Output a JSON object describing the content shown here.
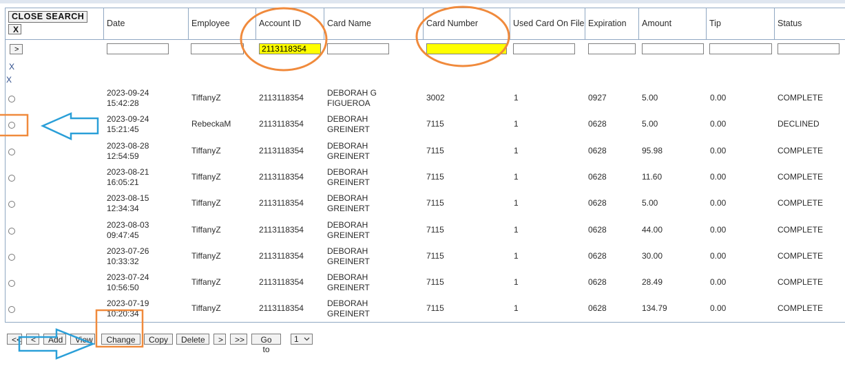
{
  "grid": {
    "close_search_label": "CLOSE SEARCH",
    "close_x_label": "X",
    "apply_filter_label": ">",
    "clear_marks": [
      "X",
      "X"
    ],
    "columns": [
      "Date",
      "Employee",
      "Account ID",
      "Card Name",
      "Card Number",
      "Used Card On File",
      "Expiration",
      "Amount",
      "Tip",
      "Status"
    ],
    "filters": {
      "date": "",
      "employee": "",
      "account_id": "2113118354",
      "card_name": "",
      "card_number": "",
      "used_card": "",
      "expiration": "",
      "amount": "",
      "tip": "",
      "status": ""
    },
    "highlight_color": "#ffff00",
    "rows": [
      {
        "date": "2023-09-24",
        "time": "15:42:28",
        "employee": "TiffanyZ",
        "account_id": "2113118354",
        "card_name_1": "DEBORAH G",
        "card_name_2": "FIGUEROA",
        "card_number": "3002",
        "used_card": "1",
        "expiration": "0927",
        "amount": "5.00",
        "tip": "0.00",
        "status": "COMPLETE"
      },
      {
        "date": "2023-09-24",
        "time": "15:21:45",
        "employee": "RebeckaM",
        "account_id": "2113118354",
        "card_name_1": "DEBORAH",
        "card_name_2": "GREINERT",
        "card_number": "7115",
        "used_card": "1",
        "expiration": "0628",
        "amount": "5.00",
        "tip": "0.00",
        "status": "DECLINED"
      },
      {
        "date": "2023-08-28",
        "time": "12:54:59",
        "employee": "TiffanyZ",
        "account_id": "2113118354",
        "card_name_1": "DEBORAH",
        "card_name_2": "GREINERT",
        "card_number": "7115",
        "used_card": "1",
        "expiration": "0628",
        "amount": "95.98",
        "tip": "0.00",
        "status": "COMPLETE"
      },
      {
        "date": "2023-08-21",
        "time": "16:05:21",
        "employee": "TiffanyZ",
        "account_id": "2113118354",
        "card_name_1": "DEBORAH",
        "card_name_2": "GREINERT",
        "card_number": "7115",
        "used_card": "1",
        "expiration": "0628",
        "amount": "11.60",
        "tip": "0.00",
        "status": "COMPLETE"
      },
      {
        "date": "2023-08-15",
        "time": "12:34:34",
        "employee": "TiffanyZ",
        "account_id": "2113118354",
        "card_name_1": "DEBORAH",
        "card_name_2": "GREINERT",
        "card_number": "7115",
        "used_card": "1",
        "expiration": "0628",
        "amount": "5.00",
        "tip": "0.00",
        "status": "COMPLETE"
      },
      {
        "date": "2023-08-03",
        "time": "09:47:45",
        "employee": "TiffanyZ",
        "account_id": "2113118354",
        "card_name_1": "DEBORAH",
        "card_name_2": "GREINERT",
        "card_number": "7115",
        "used_card": "1",
        "expiration": "0628",
        "amount": "44.00",
        "tip": "0.00",
        "status": "COMPLETE"
      },
      {
        "date": "2023-07-26",
        "time": "10:33:32",
        "employee": "TiffanyZ",
        "account_id": "2113118354",
        "card_name_1": "DEBORAH",
        "card_name_2": "GREINERT",
        "card_number": "7115",
        "used_card": "1",
        "expiration": "0628",
        "amount": "30.00",
        "tip": "0.00",
        "status": "COMPLETE"
      },
      {
        "date": "2023-07-24",
        "time": "10:56:50",
        "employee": "TiffanyZ",
        "account_id": "2113118354",
        "card_name_1": "DEBORAH",
        "card_name_2": "GREINERT",
        "card_number": "7115",
        "used_card": "1",
        "expiration": "0628",
        "amount": "28.49",
        "tip": "0.00",
        "status": "COMPLETE"
      },
      {
        "date": "2023-07-19",
        "time": "10:20:34",
        "employee": "TiffanyZ",
        "account_id": "2113118354",
        "card_name_1": "DEBORAH",
        "card_name_2": "GREINERT",
        "card_number": "7115",
        "used_card": "1",
        "expiration": "0628",
        "amount": "134.79",
        "tip": "0.00",
        "status": "COMPLETE"
      }
    ]
  },
  "pager": {
    "first_label": "<<",
    "prev_label": "<",
    "add_label": "Add",
    "view_label": "View",
    "change_label": "Change",
    "copy_label": "Copy",
    "delete_label": "Delete",
    "next_label": ">",
    "last_label": ">>",
    "goto_label": "Go to",
    "page_value": "1",
    "page_chevron": "chevron-down-icon"
  },
  "annotations": {
    "circle_color": "#f08a3c",
    "box_color": "#f08a3c",
    "arrow_color": "#2a9fd8",
    "circles": [
      "account-id",
      "card-number"
    ],
    "boxes": [
      "row-2-radio",
      "change-button"
    ],
    "arrows": [
      "row-2-radio",
      "change-button"
    ]
  }
}
